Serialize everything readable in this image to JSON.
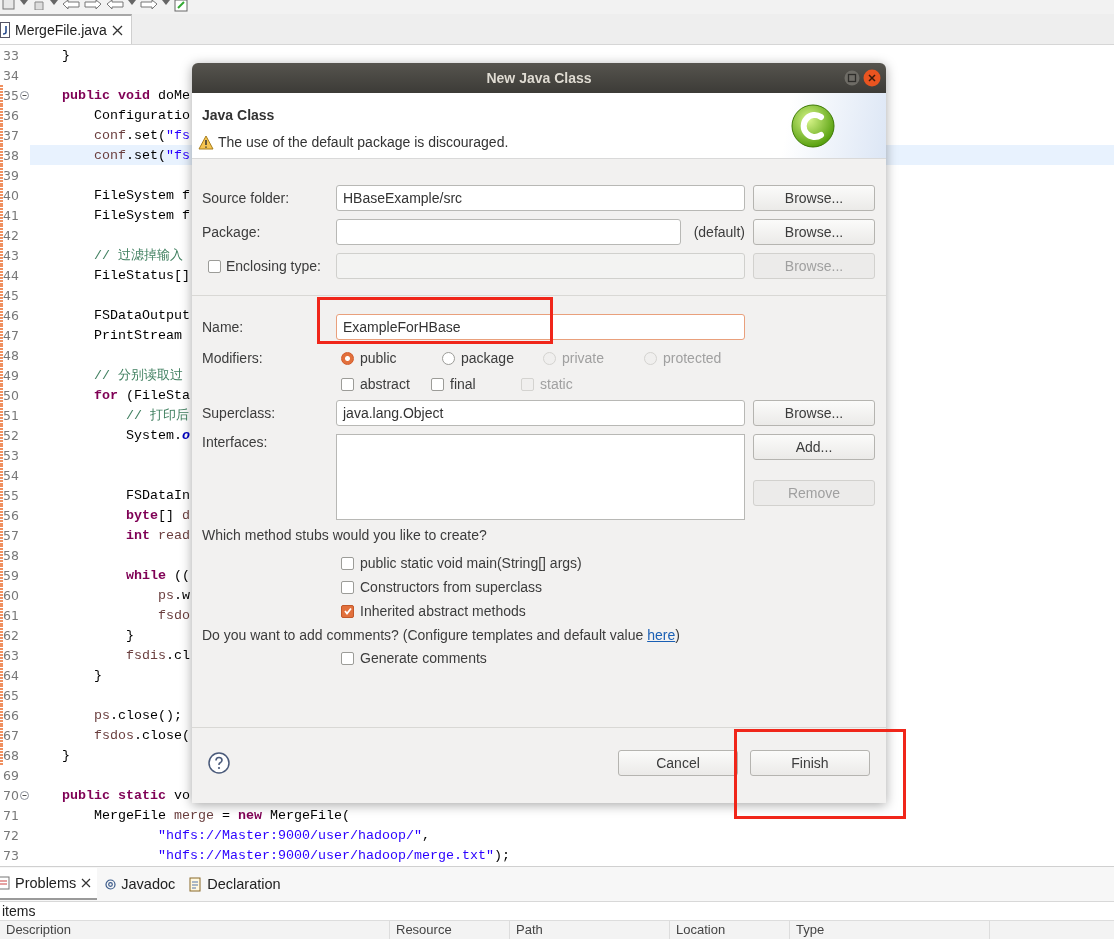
{
  "editor": {
    "tab": {
      "label": "MergeFile.java",
      "selected": true
    },
    "code_lines": [
      {
        "number": "33",
        "current": false,
        "changed": false,
        "collapsible": false,
        "segments": [
          {
            "kind": "plain",
            "text": "    }"
          }
        ]
      },
      {
        "number": "34",
        "current": false,
        "changed": false,
        "collapsible": false
      },
      {
        "number": "35",
        "current": false,
        "changed": true,
        "collapsible": true,
        "segments": [
          {
            "kind": "keyword",
            "text": "    public void"
          },
          {
            "kind": "plain",
            "text": " doMe"
          }
        ]
      },
      {
        "number": "36",
        "current": false,
        "changed": true,
        "collapsible": false,
        "segments": [
          {
            "kind": "plain",
            "text": "        Configuratio"
          }
        ]
      },
      {
        "number": "37",
        "current": false,
        "changed": true,
        "collapsible": false,
        "segments": [
          {
            "kind": "local",
            "text": "        conf"
          },
          {
            "kind": "plain",
            "text": ".set("
          },
          {
            "kind": "string",
            "text": "\"fs"
          }
        ]
      },
      {
        "number": "38",
        "current": true,
        "changed": true,
        "collapsible": false,
        "segments": [
          {
            "kind": "local",
            "text": "        conf"
          },
          {
            "kind": "plain",
            "text": ".set("
          },
          {
            "kind": "string",
            "text": "\"fs"
          }
        ]
      },
      {
        "number": "39",
        "current": false,
        "changed": true,
        "collapsible": false
      },
      {
        "number": "40",
        "current": false,
        "changed": true,
        "collapsible": false,
        "segments": [
          {
            "kind": "plain",
            "text": "        FileSystem f"
          }
        ]
      },
      {
        "number": "41",
        "current": false,
        "changed": true,
        "collapsible": false,
        "segments": [
          {
            "kind": "plain",
            "text": "        FileSystem f"
          }
        ]
      },
      {
        "number": "42",
        "current": false,
        "changed": true,
        "collapsible": false
      },
      {
        "number": "43",
        "current": false,
        "changed": true,
        "collapsible": false,
        "segments": [
          {
            "kind": "comment",
            "text": "        // 过滤掉输入"
          }
        ]
      },
      {
        "number": "44",
        "current": false,
        "changed": true,
        "collapsible": false,
        "segments": [
          {
            "kind": "plain",
            "text": "        FileStatus[]"
          }
        ]
      },
      {
        "number": "45",
        "current": false,
        "changed": true,
        "collapsible": false
      },
      {
        "number": "46",
        "current": false,
        "changed": true,
        "collapsible": false,
        "segments": [
          {
            "kind": "plain",
            "text": "        FSDataOutput"
          }
        ]
      },
      {
        "number": "47",
        "current": false,
        "changed": true,
        "collapsible": false,
        "segments": [
          {
            "kind": "plain",
            "text": "        PrintStream"
          }
        ]
      },
      {
        "number": "48",
        "current": false,
        "changed": true,
        "collapsible": false
      },
      {
        "number": "49",
        "current": false,
        "changed": true,
        "collapsible": false,
        "segments": [
          {
            "kind": "comment",
            "text": "        // 分别读取过"
          }
        ]
      },
      {
        "number": "50",
        "current": false,
        "changed": true,
        "collapsible": false,
        "segments": [
          {
            "kind": "keyword",
            "text": "        for"
          },
          {
            "kind": "plain",
            "text": " (FileSta"
          }
        ]
      },
      {
        "number": "51",
        "current": false,
        "changed": true,
        "collapsible": false,
        "segments": [
          {
            "kind": "comment",
            "text": "            // 打印后"
          }
        ]
      },
      {
        "number": "52",
        "current": false,
        "changed": true,
        "collapsible": false,
        "segments": [
          {
            "kind": "plain",
            "text": "            System."
          },
          {
            "kind": "static_field",
            "text": "o"
          }
        ]
      },
      {
        "number": "53",
        "current": false,
        "changed": true,
        "collapsible": false
      },
      {
        "number": "54",
        "current": false,
        "changed": true,
        "collapsible": false
      },
      {
        "number": "55",
        "current": false,
        "changed": true,
        "collapsible": false,
        "segments": [
          {
            "kind": "plain",
            "text": "            FSDataIn"
          }
        ]
      },
      {
        "number": "56",
        "current": false,
        "changed": true,
        "collapsible": false,
        "segments": [
          {
            "kind": "keyword",
            "text": "            byte"
          },
          {
            "kind": "plain",
            "text": "[]"
          },
          {
            "kind": "local",
            "text": " d"
          }
        ]
      },
      {
        "number": "57",
        "current": false,
        "changed": true,
        "collapsible": false,
        "segments": [
          {
            "kind": "keyword",
            "text": "            int"
          },
          {
            "kind": "local",
            "text": " read"
          }
        ]
      },
      {
        "number": "58",
        "current": false,
        "changed": true,
        "collapsible": false
      },
      {
        "number": "59",
        "current": false,
        "changed": true,
        "collapsible": false,
        "segments": [
          {
            "kind": "keyword",
            "text": "            while"
          },
          {
            "kind": "plain",
            "text": " (("
          }
        ]
      },
      {
        "number": "60",
        "current": false,
        "changed": true,
        "collapsible": false,
        "segments": [
          {
            "kind": "local",
            "text": "                ps"
          },
          {
            "kind": "plain",
            "text": ".w"
          }
        ]
      },
      {
        "number": "61",
        "current": false,
        "changed": true,
        "collapsible": false,
        "segments": [
          {
            "kind": "local",
            "text": "                fsdo"
          }
        ]
      },
      {
        "number": "62",
        "current": false,
        "changed": true,
        "collapsible": false,
        "segments": [
          {
            "kind": "plain",
            "text": "            }"
          }
        ]
      },
      {
        "number": "63",
        "current": false,
        "changed": true,
        "collapsible": false,
        "segments": [
          {
            "kind": "local",
            "text": "            fsdis"
          },
          {
            "kind": "plain",
            "text": ".cl"
          }
        ]
      },
      {
        "number": "64",
        "current": false,
        "changed": true,
        "collapsible": false,
        "segments": [
          {
            "kind": "plain",
            "text": "        }"
          }
        ]
      },
      {
        "number": "65",
        "current": false,
        "changed": true,
        "collapsible": false
      },
      {
        "number": "66",
        "current": false,
        "changed": true,
        "collapsible": false,
        "segments": [
          {
            "kind": "local",
            "text": "        ps"
          },
          {
            "kind": "plain",
            "text": ".close();"
          }
        ]
      },
      {
        "number": "67",
        "current": false,
        "changed": true,
        "collapsible": false,
        "segments": [
          {
            "kind": "local",
            "text": "        fsdos"
          },
          {
            "kind": "plain",
            "text": ".close("
          }
        ]
      },
      {
        "number": "68",
        "current": false,
        "changed": true,
        "collapsible": false,
        "segments": [
          {
            "kind": "plain",
            "text": "    }"
          }
        ]
      },
      {
        "number": "69",
        "current": false,
        "changed": false,
        "collapsible": false
      },
      {
        "number": "70",
        "current": false,
        "changed": false,
        "collapsible": true,
        "segments": [
          {
            "kind": "keyword",
            "text": "    public static"
          },
          {
            "kind": "plain",
            "text": " vo"
          }
        ]
      },
      {
        "number": "71",
        "current": false,
        "changed": false,
        "collapsible": false,
        "segments": [
          {
            "kind": "plain",
            "text": "        MergeFile"
          },
          {
            "kind": "local",
            "text": " merge"
          },
          {
            "kind": "plain",
            "text": " ="
          },
          {
            "kind": "keyword",
            "text": " new"
          },
          {
            "kind": "plain",
            "text": " MergeFile("
          }
        ]
      },
      {
        "number": "72",
        "current": false,
        "changed": false,
        "collapsible": false,
        "segments": [
          {
            "kind": "string",
            "text": "                \"hdfs://Master:9000/user/hadoop/\""
          },
          {
            "kind": "plain",
            "text": ","
          }
        ]
      },
      {
        "number": "73",
        "current": false,
        "changed": false,
        "collapsible": false,
        "segments": [
          {
            "kind": "string",
            "text": "                \"hdfs://Master:9000/user/hadoop/merge.txt\""
          },
          {
            "kind": "plain",
            "text": ");"
          }
        ]
      }
    ]
  },
  "dialog": {
    "title": "New Java Class",
    "header": {
      "title": "Java Class",
      "message": "The use of the default package is discouraged."
    },
    "source_folder": {
      "label": "Source folder:",
      "value": "HBaseExample/src",
      "button": {
        "label": "Browse...",
        "disabled": false
      }
    },
    "package": {
      "label": "Package:",
      "suffix": "(default)",
      "button": {
        "label": "Browse...",
        "disabled": false
      }
    },
    "enclosing_type": {
      "label": "Enclosing type:",
      "checked": false,
      "button": {
        "label": "Browse...",
        "disabled": true
      }
    },
    "name": {
      "label": "Name:",
      "value": "ExampleForHBase",
      "focused": true
    },
    "modifiers": {
      "label": "Modifiers:",
      "visibility": [
        {
          "label": "public",
          "selected": true,
          "disabled": false
        },
        {
          "label": "package",
          "selected": false,
          "disabled": false
        },
        {
          "label": "private",
          "selected": false,
          "disabled": true
        },
        {
          "label": "protected",
          "selected": false,
          "disabled": true
        }
      ],
      "flags": [
        {
          "label": "abstract",
          "checked": false,
          "disabled": false
        },
        {
          "label": "final",
          "checked": false,
          "disabled": false
        },
        {
          "label": "static",
          "checked": false,
          "disabled": true
        }
      ]
    },
    "superclass": {
      "label": "Superclass:",
      "value": "java.lang.Object",
      "button": {
        "label": "Browse...",
        "disabled": false
      }
    },
    "interfaces": {
      "label": "Interfaces:",
      "buttons": [
        {
          "label": "Add...",
          "disabled": false
        },
        {
          "label": "Remove",
          "disabled": true
        }
      ]
    },
    "stubs_question": "Which method stubs would you like to create?",
    "stubs": [
      {
        "label": "public static void main(String[] args)",
        "checked": false
      },
      {
        "label": "Constructors from superclass",
        "checked": false
      },
      {
        "label": "Inherited abstract methods",
        "checked": true
      }
    ],
    "comments_question": {
      "text": "Do you want to add comments? (Configure templates and default value ",
      "link": "here",
      "after": ")"
    },
    "generate_comments": {
      "label": "Generate comments",
      "checked": false
    },
    "buttons": [
      {
        "label": "Cancel"
      },
      {
        "label": "Finish"
      }
    ]
  },
  "bottom_panel": {
    "tabs": [
      {
        "label": "Problems",
        "selected": true
      },
      {
        "label": "Javadoc",
        "selected": false
      },
      {
        "label": "Declaration",
        "selected": false
      }
    ],
    "summary": "items",
    "columns": [
      "Description",
      "Resource",
      "Path",
      "Location",
      "Type"
    ]
  }
}
